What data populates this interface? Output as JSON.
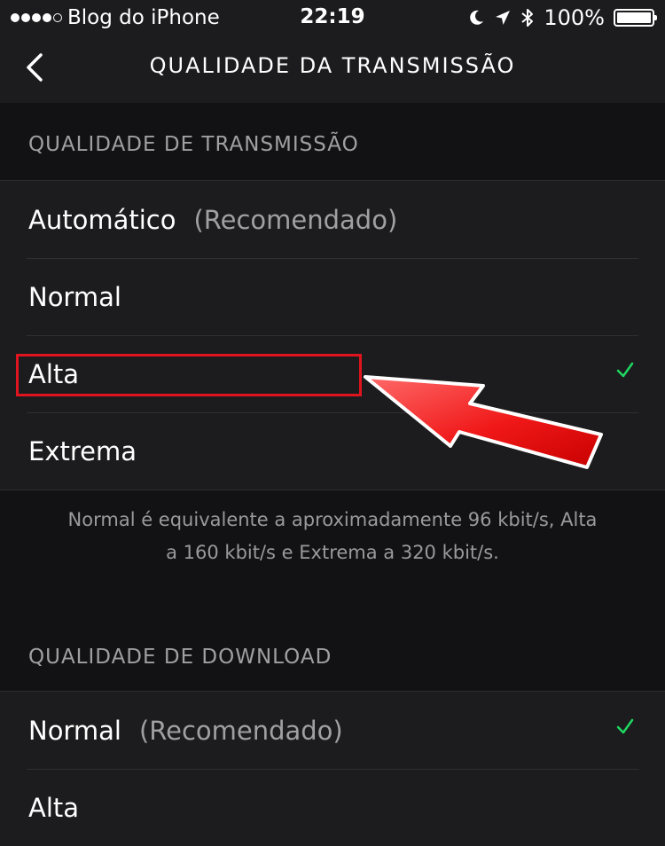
{
  "status_bar": {
    "carrier": "Blog do iPhone",
    "time": "22:19",
    "battery": "100%",
    "signal_bars": 4,
    "signal_total": 5
  },
  "nav": {
    "title": "QUALIDADE DA TRANSMISSÃO",
    "back_icon": "chevron-left-icon"
  },
  "streaming": {
    "header": "QUALIDADE DE TRANSMISSÃO",
    "options": [
      {
        "label": "Automático",
        "note": "(Recomendado)",
        "selected": false
      },
      {
        "label": "Normal",
        "note": "",
        "selected": false
      },
      {
        "label": "Alta",
        "note": "",
        "selected": true
      },
      {
        "label": "Extrema",
        "note": "",
        "selected": false
      }
    ],
    "footer_line1": "Normal é equivalente a aproximadamente 96 kbit/s, Alta",
    "footer_line2": "a 160 kbit/s e Extrema a 320 kbit/s."
  },
  "download": {
    "header": "QUALIDADE DE DOWNLOAD",
    "options": [
      {
        "label": "Normal",
        "note": "(Recomendado)",
        "selected": true
      },
      {
        "label": "Alta",
        "note": "",
        "selected": false
      }
    ]
  },
  "colors": {
    "accent_check": "#1ed760",
    "annotation_red": "#e0141e"
  }
}
